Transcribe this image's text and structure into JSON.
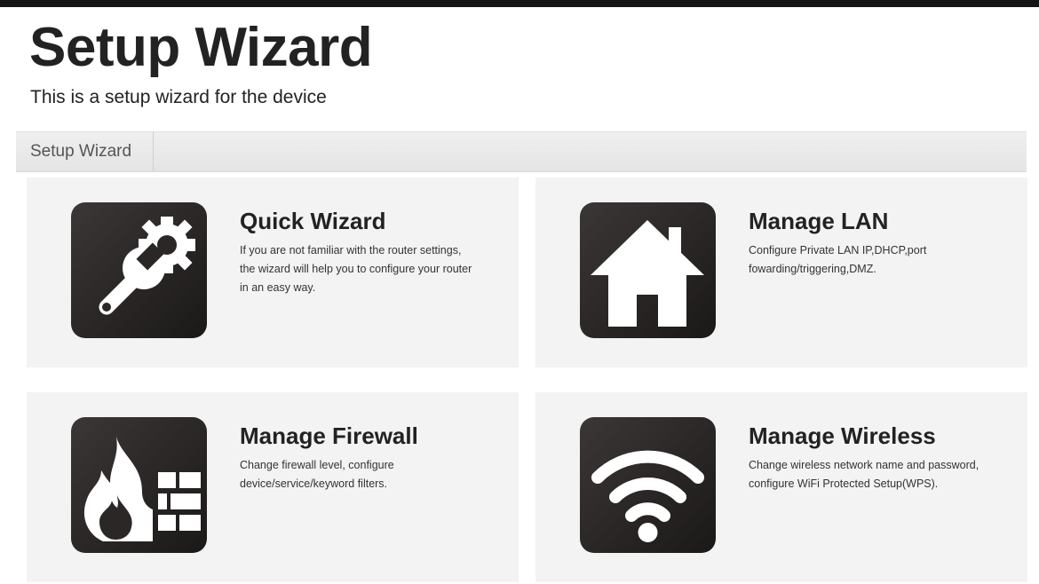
{
  "page": {
    "title": "Setup Wizard",
    "subtitle": "This is a setup wizard for the device"
  },
  "section": {
    "label": "Setup Wizard"
  },
  "tiles": [
    {
      "title": "Quick Wizard",
      "description": "If you are not familiar with the router settings, the wizard will help you to configure your router in an easy way.",
      "icon": "wrench-gear-icon"
    },
    {
      "title": "Manage LAN",
      "description": "Configure Private LAN IP,DHCP,port fowarding/triggering,DMZ.",
      "icon": "house-icon"
    },
    {
      "title": "Manage Firewall",
      "description": "Change firewall level, configure device/service/keyword filters.",
      "icon": "firewall-icon"
    },
    {
      "title": "Manage Wireless",
      "description": "Change wireless network name and password, configure WiFi Protected Setup(WPS).",
      "icon": "wifi-icon"
    }
  ],
  "colors": {
    "icon_background": "#2b2727",
    "icon_glyph": "#ffffff",
    "tile_background": "#f3f3f3",
    "section_bar": "#e8e8e8"
  }
}
